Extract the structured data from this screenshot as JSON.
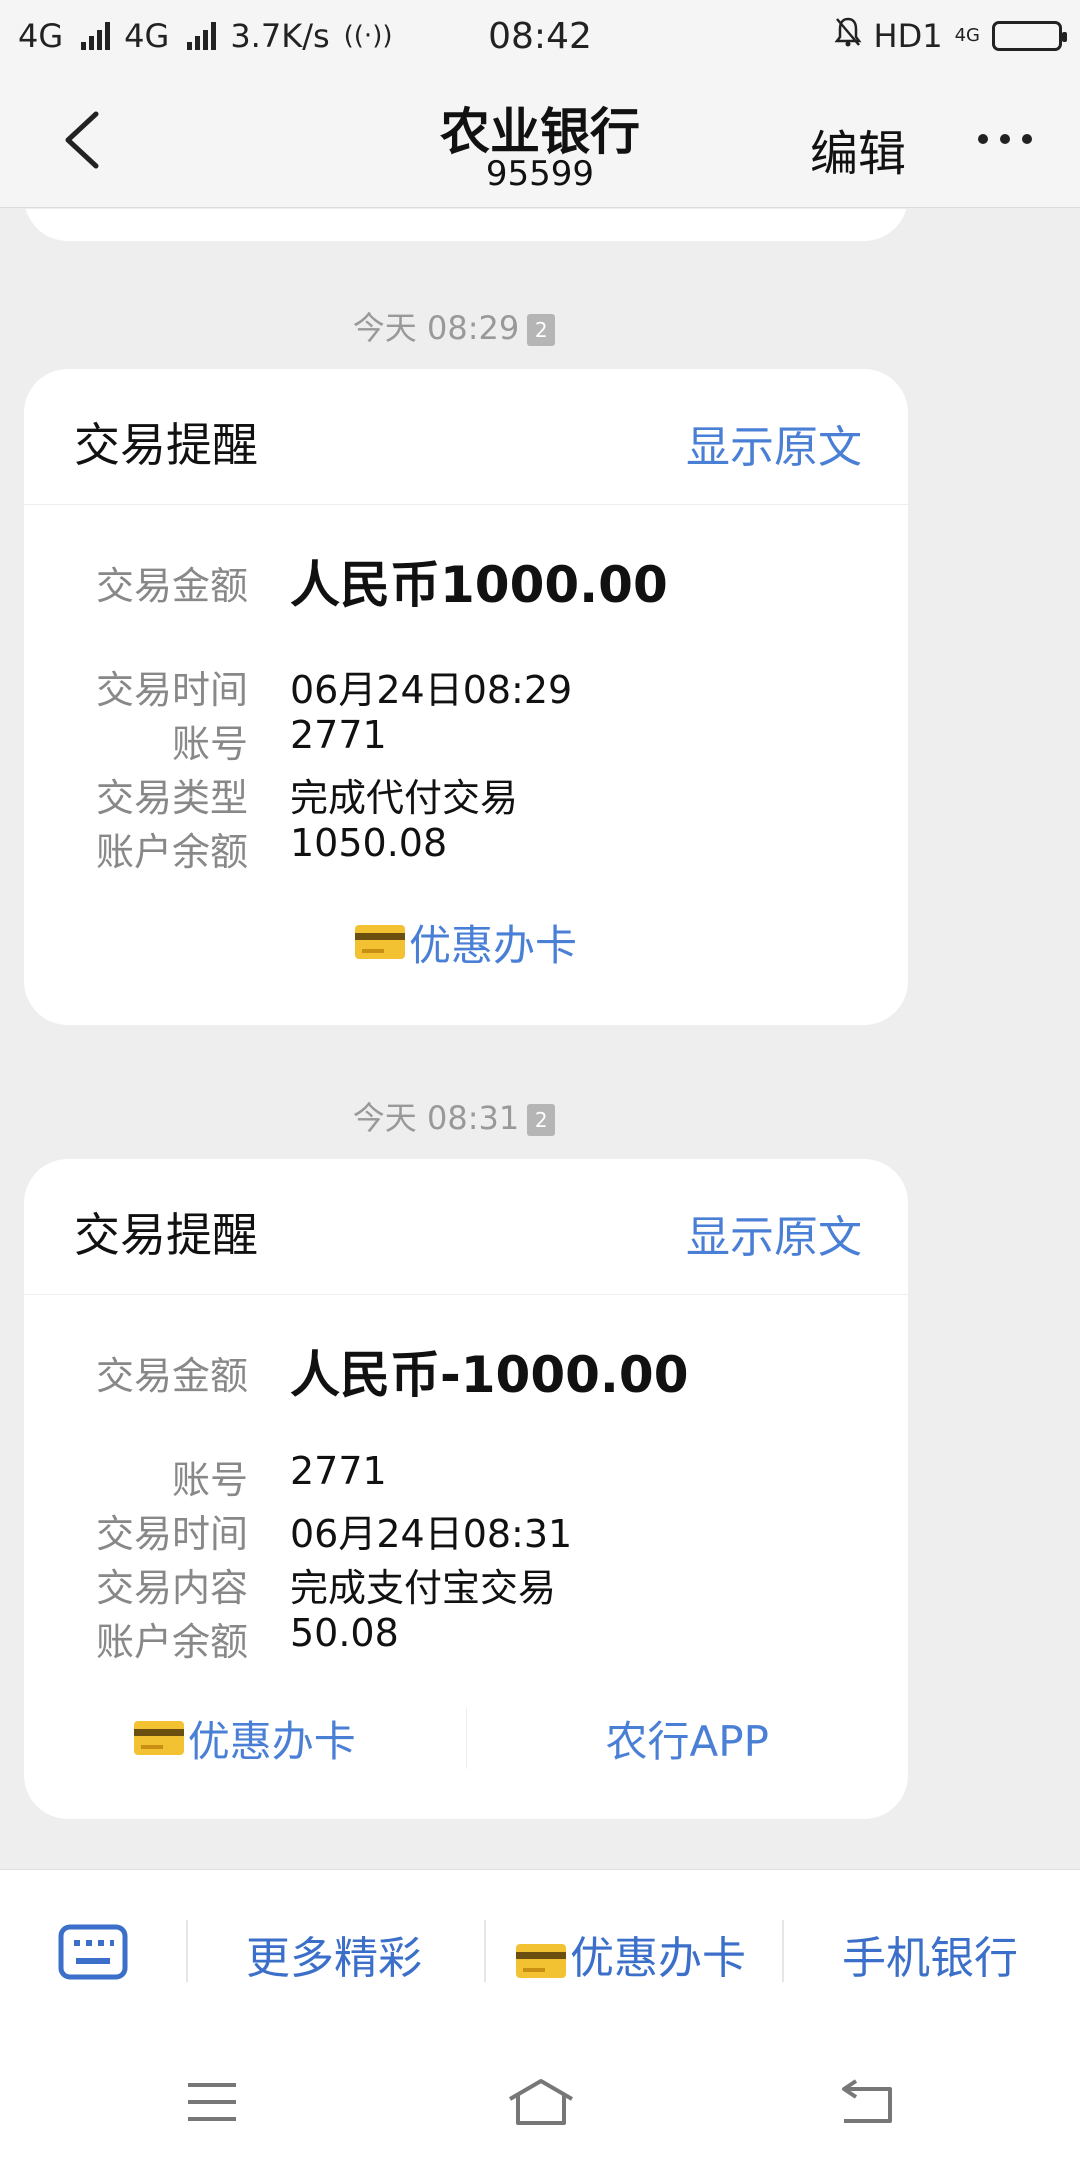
{
  "status": {
    "net1": "4G",
    "net2": "4G",
    "speed": "3.7K/s",
    "time": "08:42",
    "hd": "HD1",
    "net3": "4G"
  },
  "nav": {
    "title": "农业银行",
    "subtitle": "95599",
    "edit": "编辑"
  },
  "messages": [
    {
      "timestamp": "今天 08:29",
      "sim": "2",
      "title": "交易提醒",
      "show_original": "显示原文",
      "amount_label": "交易金额",
      "amount": "人民币1000.00",
      "rows": [
        {
          "label": "交易时间",
          "value": "06月24日08:29"
        },
        {
          "label": "账号",
          "value": "2771"
        },
        {
          "label": "交易类型",
          "value": "完成代付交易"
        },
        {
          "label": "账户余额",
          "value": "1050.08"
        }
      ],
      "links": [
        "优惠办卡"
      ]
    },
    {
      "timestamp": "今天 08:31",
      "sim": "2",
      "title": "交易提醒",
      "show_original": "显示原文",
      "amount_label": "交易金额",
      "amount": "人民币-1000.00",
      "rows": [
        {
          "label": "账号",
          "value": "2771"
        },
        {
          "label": "交易时间",
          "value": "06月24日08:31"
        },
        {
          "label": "交易内容",
          "value": "完成支付宝交易"
        },
        {
          "label": "账户余额",
          "value": "50.08"
        }
      ],
      "links": [
        "优惠办卡",
        "农行APP"
      ]
    }
  ],
  "menu": {
    "items": [
      "更多精彩",
      "优惠办卡",
      "手机银行"
    ]
  },
  "colors": {
    "link_blue": "#4a7fd6",
    "background": "#eeeeee",
    "card": "#ffffff"
  },
  "icons": {
    "back": "chevron-left-icon",
    "more": "more-dots-icon",
    "keyboard": "keyboard-icon",
    "bank_card": "bank-card-icon",
    "menu": "menu-icon",
    "home": "home-icon",
    "return": "return-icon"
  }
}
